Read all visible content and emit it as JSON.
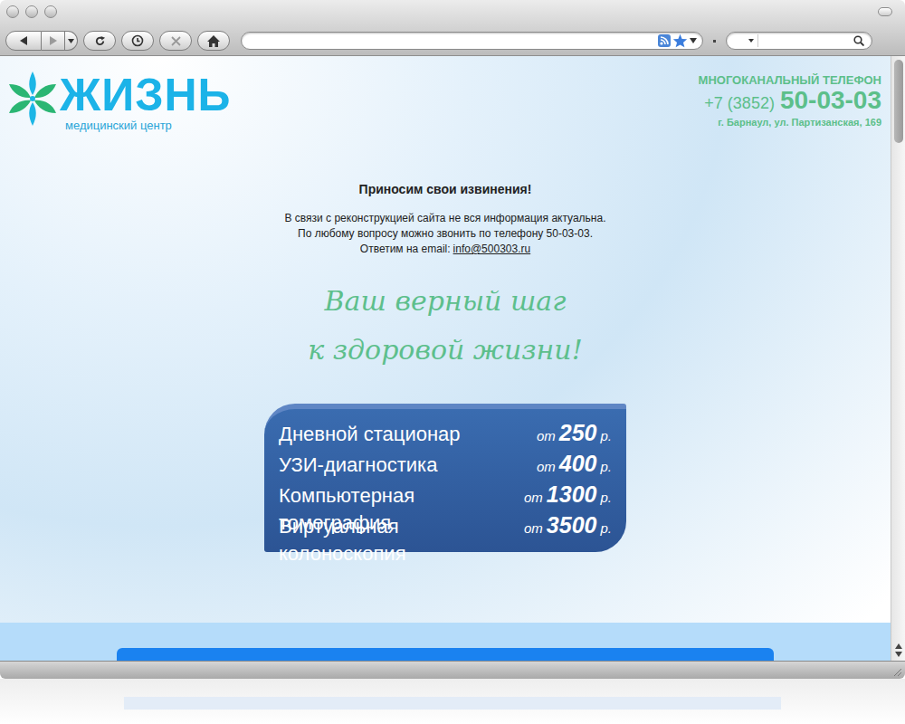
{
  "site": {
    "logo": {
      "name": "ЖИЗНЬ",
      "subtitle": "медицинский центр"
    },
    "contact": {
      "label": "МНОГОКАНАЛЬНЫЙ ТЕЛЕФОН",
      "phone_prefix": "+7 (3852)",
      "phone": "50-03-03",
      "address": "г. Барнаул, ул. Партизанская, 169"
    },
    "notice": {
      "title": "Приносим свои извинения!",
      "lines": [
        "В связи с реконструкцией сайта не вся информация актуальна.",
        "По любому вопросу можно звонить по телефону 50-03-03."
      ],
      "email_label": "Ответим на email:",
      "email": "info@500303.ru"
    },
    "slogan": [
      "Ваш верный шаг",
      "к здоровой жизни!"
    ],
    "prices": [
      {
        "service": "Дневной стационар",
        "from": "от",
        "price": "250",
        "unit": "р."
      },
      {
        "service": "УЗИ-диагностика",
        "from": "от",
        "price": "400",
        "unit": "р."
      },
      {
        "service": "Компьютерная томография",
        "from": "от",
        "price": "1300",
        "unit": "р."
      },
      {
        "service": "Виртуальная колоноскопия",
        "from": "от",
        "price": "3500",
        "unit": "р."
      }
    ]
  }
}
